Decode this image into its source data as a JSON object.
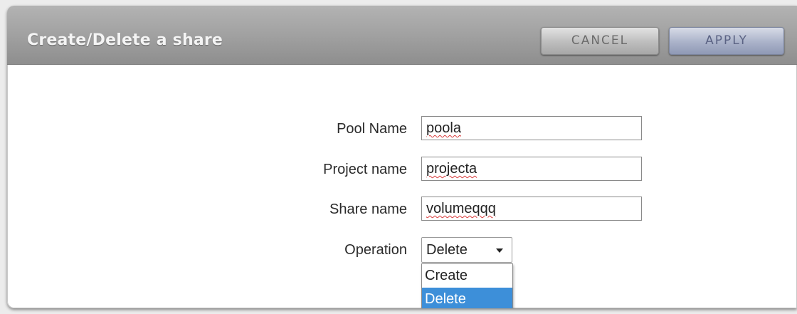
{
  "dialog": {
    "title": "Create/Delete a share",
    "cancel_label": "CANCEL",
    "apply_label": "APPLY"
  },
  "form": {
    "pool_name": {
      "label": "Pool Name",
      "value": "poola"
    },
    "project_name": {
      "label": "Project name",
      "value": "projecta"
    },
    "share_name": {
      "label": "Share name",
      "value": "volumeqqq"
    },
    "operation": {
      "label": "Operation",
      "selected": "Delete",
      "options": [
        "Create",
        "Delete"
      ],
      "highlighted_option": "Delete"
    }
  },
  "colors": {
    "titlebar": "#a3a3a3",
    "highlight": "#3d8fd9",
    "apply_button": "#aab2c9"
  },
  "icons": {
    "dropdown_caret": "caret-down-icon"
  }
}
